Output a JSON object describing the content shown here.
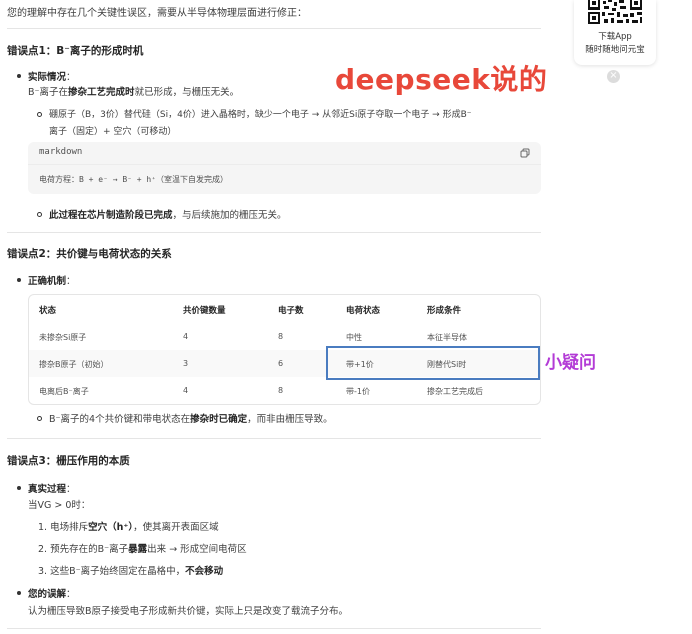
{
  "intro": "您的理解中存在几个关键性误区，需要从半导体物理层面进行修正：",
  "sections": [
    {
      "title": "错误点1：B⁻离子的形成时机",
      "bullet1_label": "实际情况",
      "bullet1_colon": "：",
      "line1_pre": "B⁻离子在",
      "line1_bold1": "掺杂工艺完成时",
      "line1_post": "就已形成，与栅压无关。",
      "sub1_line1": "硼原子（B，3价）替代硅（Si，4价）进入晶格时，缺少一个电子 → 从邻近Si原子夺取一个电子 → 形成B⁻",
      "sub1_line2": "离子（固定）+ 空穴（可移动）",
      "code_lang": "markdown",
      "code_text": "电荷方程：B + e⁻ → B⁻ + h⁺（室温下自发完成）",
      "sub2_bold": "此过程在芯片制造阶段已完成",
      "sub2_post": "，与后续施加的栅压无关。"
    },
    {
      "title": "错误点2：共价键与电荷状态的关系",
      "bullet1_label": "正确机制",
      "bullet1_colon": "：",
      "table": {
        "headers": [
          "状态",
          "共价键数量",
          "电子数",
          "电荷状态",
          "形成条件"
        ],
        "rows": [
          [
            "未掺杂Si原子",
            "4",
            "8",
            "中性",
            "本征半导体"
          ],
          [
            "掺杂B原子（初始）",
            "3",
            "6",
            "带+1价",
            "刚替代Si时"
          ],
          [
            "电离后B⁻离子",
            "4",
            "8",
            "带-1价",
            "掺杂工艺完成后"
          ]
        ]
      },
      "sub_pre": "B⁻离子的4个共价键和带电状态在",
      "sub_bold": "掺杂时已确定",
      "sub_post": "，而非由栅压导致。"
    },
    {
      "title": "错误点3：栅压作用的本质",
      "bullet1_label": "真实过程",
      "bullet1_colon": "：",
      "cond": "当VG > 0时：",
      "steps": [
        {
          "num": "1.",
          "pre": "电场排斥",
          "bold": "空穴（h⁺）",
          "post": "，使其离开表面区域"
        },
        {
          "num": "2.",
          "pre": "预先存在的B⁻离子",
          "bold": "暴露",
          "post": "出来 → 形成空间电荷区"
        },
        {
          "num": "3.",
          "pre": "这些B⁻离子始终固定在晶格中，",
          "bold": "不会移动",
          "post": ""
        }
      ],
      "bullet2_label": "您的误解",
      "bullet2_colon": "：",
      "bullet2_text": "认为栅压导致B原子接受电子形成新共价键，实际上只是改变了载流子分布。"
    }
  ],
  "overlay": {
    "deepseek_label": "deepseek说的",
    "side_note": "小疑问"
  },
  "qr_card": {
    "line1": "下载App",
    "line2": "随时随地问元宝",
    "close_glyph": "×"
  },
  "colors": {
    "overlay_red": "#e8483a",
    "highlight_blue": "#4a7cc0",
    "note_purple": "#b33bd6"
  }
}
